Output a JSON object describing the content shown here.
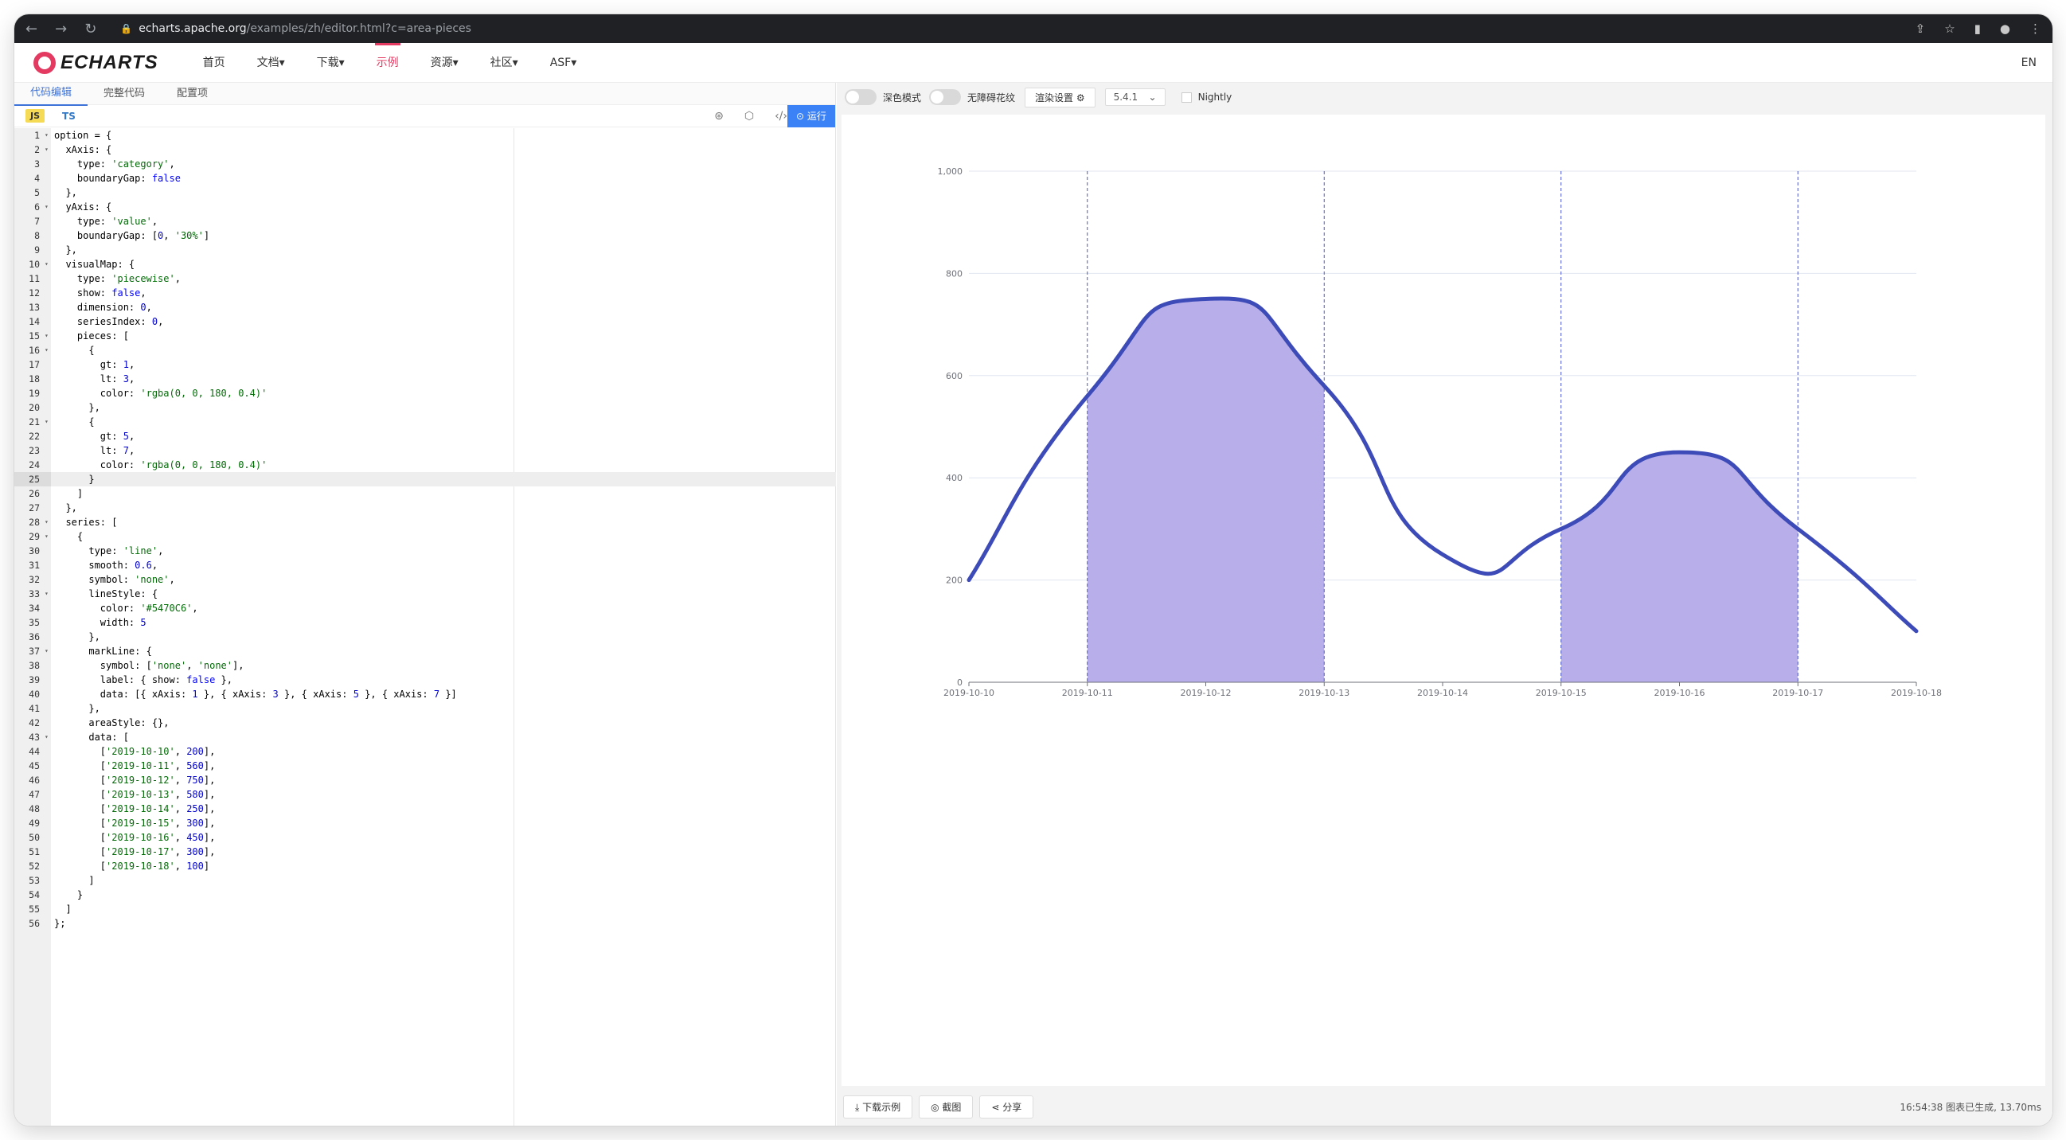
{
  "browser": {
    "url_host": "echarts.apache.org",
    "url_path": "/examples/zh/editor.html?c=area-pieces"
  },
  "header": {
    "logo_text": "ECHARTS",
    "menu": [
      "首页",
      "文档▾",
      "下载▾",
      "示例",
      "资源▾",
      "社区▾",
      "ASF▾"
    ],
    "lang": "EN"
  },
  "editor": {
    "tabs": [
      "代码编辑",
      "完整代码",
      "配置项"
    ],
    "lang_js": "JS",
    "lang_ts": "TS",
    "run_label": "运行",
    "current_line": 25,
    "lines": [
      "option = {",
      "  xAxis: {",
      "    type: 'category',",
      "    boundaryGap: false",
      "  },",
      "  yAxis: {",
      "    type: 'value',",
      "    boundaryGap: [0, '30%']",
      "  },",
      "  visualMap: {",
      "    type: 'piecewise',",
      "    show: false,",
      "    dimension: 0,",
      "    seriesIndex: 0,",
      "    pieces: [",
      "      {",
      "        gt: 1,",
      "        lt: 3,",
      "        color: 'rgba(0, 0, 180, 0.4)'",
      "      },",
      "      {",
      "        gt: 5,",
      "        lt: 7,",
      "        color: 'rgba(0, 0, 180, 0.4)'",
      "      }",
      "    ]",
      "  },",
      "  series: [",
      "    {",
      "      type: 'line',",
      "      smooth: 0.6,",
      "      symbol: 'none',",
      "      lineStyle: {",
      "        color: '#5470C6',",
      "        width: 5",
      "      },",
      "      markLine: {",
      "        symbol: ['none', 'none'],",
      "        label: { show: false },",
      "        data: [{ xAxis: 1 }, { xAxis: 3 }, { xAxis: 5 }, { xAxis: 7 }]",
      "      },",
      "      areaStyle: {},",
      "      data: [",
      "        ['2019-10-10', 200],",
      "        ['2019-10-11', 560],",
      "        ['2019-10-12', 750],",
      "        ['2019-10-13', 580],",
      "        ['2019-10-14', 250],",
      "        ['2019-10-15', 300],",
      "        ['2019-10-16', 450],",
      "        ['2019-10-17', 300],",
      "        ['2019-10-18', 100]",
      "      ]",
      "    }",
      "  ]",
      "};"
    ],
    "fold_lines": [
      1,
      2,
      6,
      10,
      15,
      16,
      21,
      28,
      29,
      33,
      37,
      43
    ]
  },
  "controls": {
    "dark_mode_label": "深色模式",
    "decal_label": "无障碍花纹",
    "render_settings_label": "渲染设置 ⚙",
    "version": "5.4.1",
    "nightly_label": "Nightly"
  },
  "bottom": {
    "download_label": "⤓  下载示例",
    "screenshot_label": "◎  截图",
    "share_label": "⋖  分享",
    "status": "16:54:38   图表已生成, 13.70ms"
  },
  "colors": {
    "accent": "#e43961",
    "line": "#3d4bb8",
    "area": "#b8aeea",
    "markline": "#4a55c8"
  },
  "chart_data": {
    "type": "area",
    "categories": [
      "2019-10-10",
      "2019-10-11",
      "2019-10-12",
      "2019-10-13",
      "2019-10-14",
      "2019-10-15",
      "2019-10-16",
      "2019-10-17",
      "2019-10-18"
    ],
    "values": [
      200,
      560,
      750,
      580,
      250,
      300,
      450,
      300,
      100
    ],
    "ylim": [
      0,
      1000
    ],
    "yticks": [
      0,
      200,
      400,
      600,
      800,
      1000
    ],
    "ytick_labels": [
      "0",
      "200",
      "400",
      "600",
      "800",
      "1,000"
    ],
    "shaded_pieces": [
      [
        1,
        3
      ],
      [
        5,
        7
      ]
    ],
    "mark_lines_x": [
      1,
      3,
      5,
      7
    ],
    "grid": true
  }
}
